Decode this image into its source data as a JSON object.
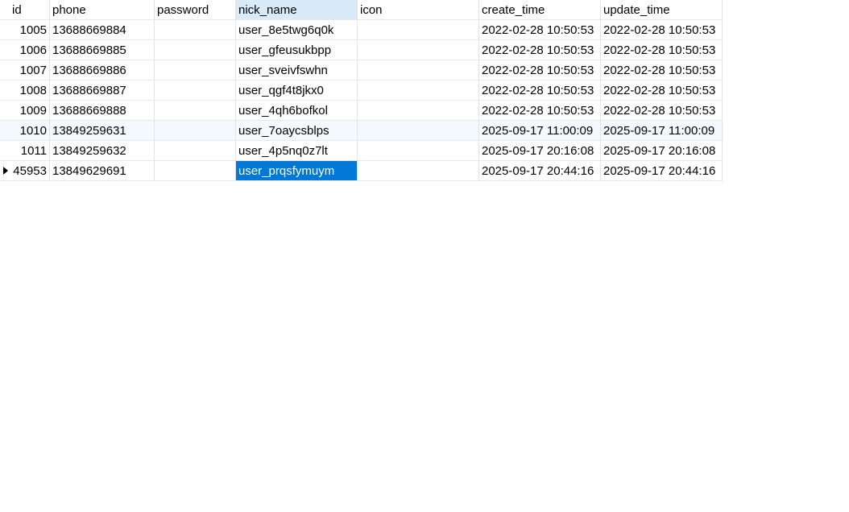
{
  "columns": [
    {
      "key": "id",
      "label": "id"
    },
    {
      "key": "phone",
      "label": "phone"
    },
    {
      "key": "password",
      "label": "password"
    },
    {
      "key": "nick_name",
      "label": "nick_name"
    },
    {
      "key": "icon",
      "label": "icon"
    },
    {
      "key": "create_time",
      "label": "create_time"
    },
    {
      "key": "update_time",
      "label": "update_time"
    }
  ],
  "rows": [
    {
      "id": "1005",
      "phone": "13688669884",
      "password": "",
      "nick_name": "user_8e5twg6q0k",
      "icon": "",
      "create_time": "2022-02-28 10:50:53",
      "update_time": "2022-02-28 10:50:53"
    },
    {
      "id": "1006",
      "phone": "13688669885",
      "password": "",
      "nick_name": "user_gfeusukbpp",
      "icon": "",
      "create_time": "2022-02-28 10:50:53",
      "update_time": "2022-02-28 10:50:53"
    },
    {
      "id": "1007",
      "phone": "13688669886",
      "password": "",
      "nick_name": "user_sveivfswhn",
      "icon": "",
      "create_time": "2022-02-28 10:50:53",
      "update_time": "2022-02-28 10:50:53"
    },
    {
      "id": "1008",
      "phone": "13688669887",
      "password": "",
      "nick_name": "user_qgf4t8jkx0",
      "icon": "",
      "create_time": "2022-02-28 10:50:53",
      "update_time": "2022-02-28 10:50:53"
    },
    {
      "id": "1009",
      "phone": "13688669888",
      "password": "",
      "nick_name": "user_4qh6bofkol",
      "icon": "",
      "create_time": "2022-02-28 10:50:53",
      "update_time": "2022-02-28 10:50:53"
    },
    {
      "id": "1010",
      "phone": "13849259631",
      "password": "",
      "nick_name": "user_7oaycsblps",
      "icon": "",
      "create_time": "2025-09-17 11:00:09",
      "update_time": "2025-09-17 11:00:09"
    },
    {
      "id": "1011",
      "phone": "13849259632",
      "password": "",
      "nick_name": "user_4p5nq0z7lt",
      "icon": "",
      "create_time": "2025-09-17 20:16:08",
      "update_time": "2025-09-17 20:16:08"
    },
    {
      "id": "45953",
      "phone": "13849629691",
      "password": "",
      "nick_name": "user_prqsfymuym",
      "icon": "",
      "create_time": "2025-09-17 20:44:16",
      "update_time": "2025-09-17 20:44:16"
    }
  ],
  "active_column": "nick_name",
  "current_row": 7,
  "colors": {
    "selection": "#0078d7",
    "active_header": "#d9ebf9",
    "alt_row": "#f4f9fd"
  }
}
